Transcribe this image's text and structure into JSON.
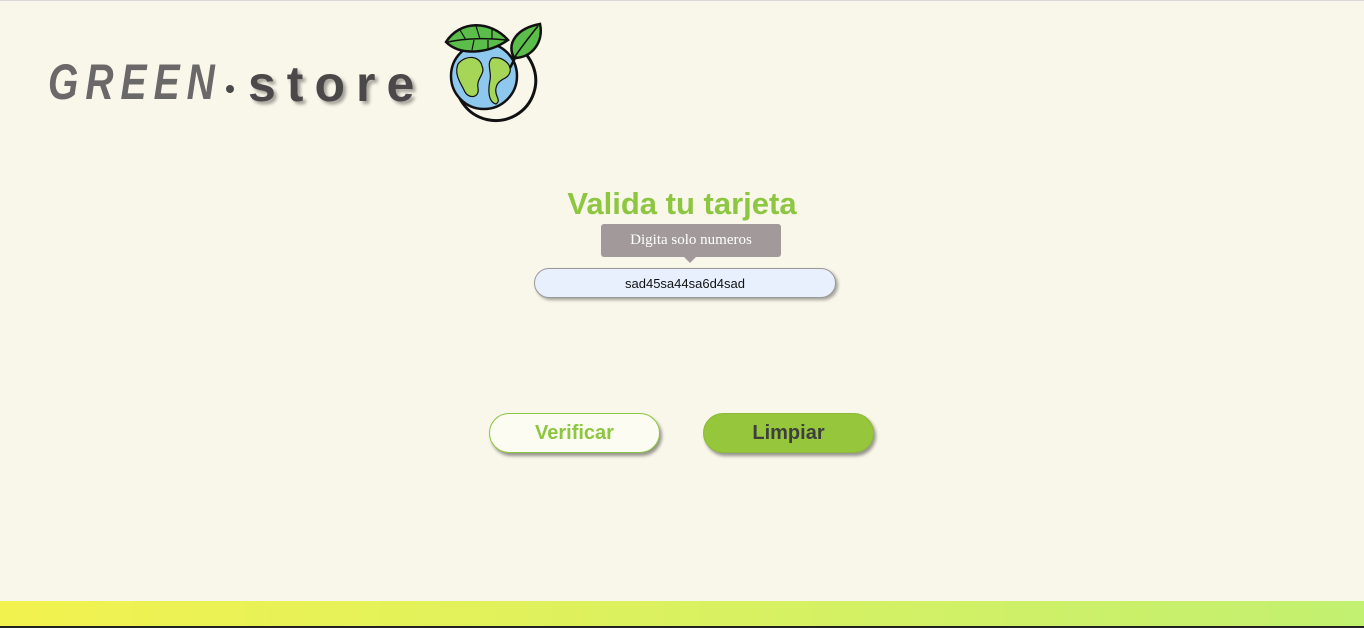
{
  "logo": {
    "part1": "GREEN",
    "part2": "store",
    "colors": {
      "text_primary": "#6a6868",
      "text_secondary": "#4a4848",
      "leaf": "#5bbd4a",
      "globe_water": "#8ec8ee",
      "globe_land": "#a6d657"
    }
  },
  "form": {
    "title": "Valida tu tarjeta",
    "tooltip": "Digita solo numeros",
    "card_input_value": "sad45sa44sa6d4sad"
  },
  "buttons": {
    "verify_label": "Verificar",
    "clear_label": "Limpiar"
  },
  "theme": {
    "background": "#f9f7ea",
    "accent": "#8dc640",
    "footer_gradient_start": "#f2f24f",
    "footer_gradient_end": "#c2f070"
  }
}
